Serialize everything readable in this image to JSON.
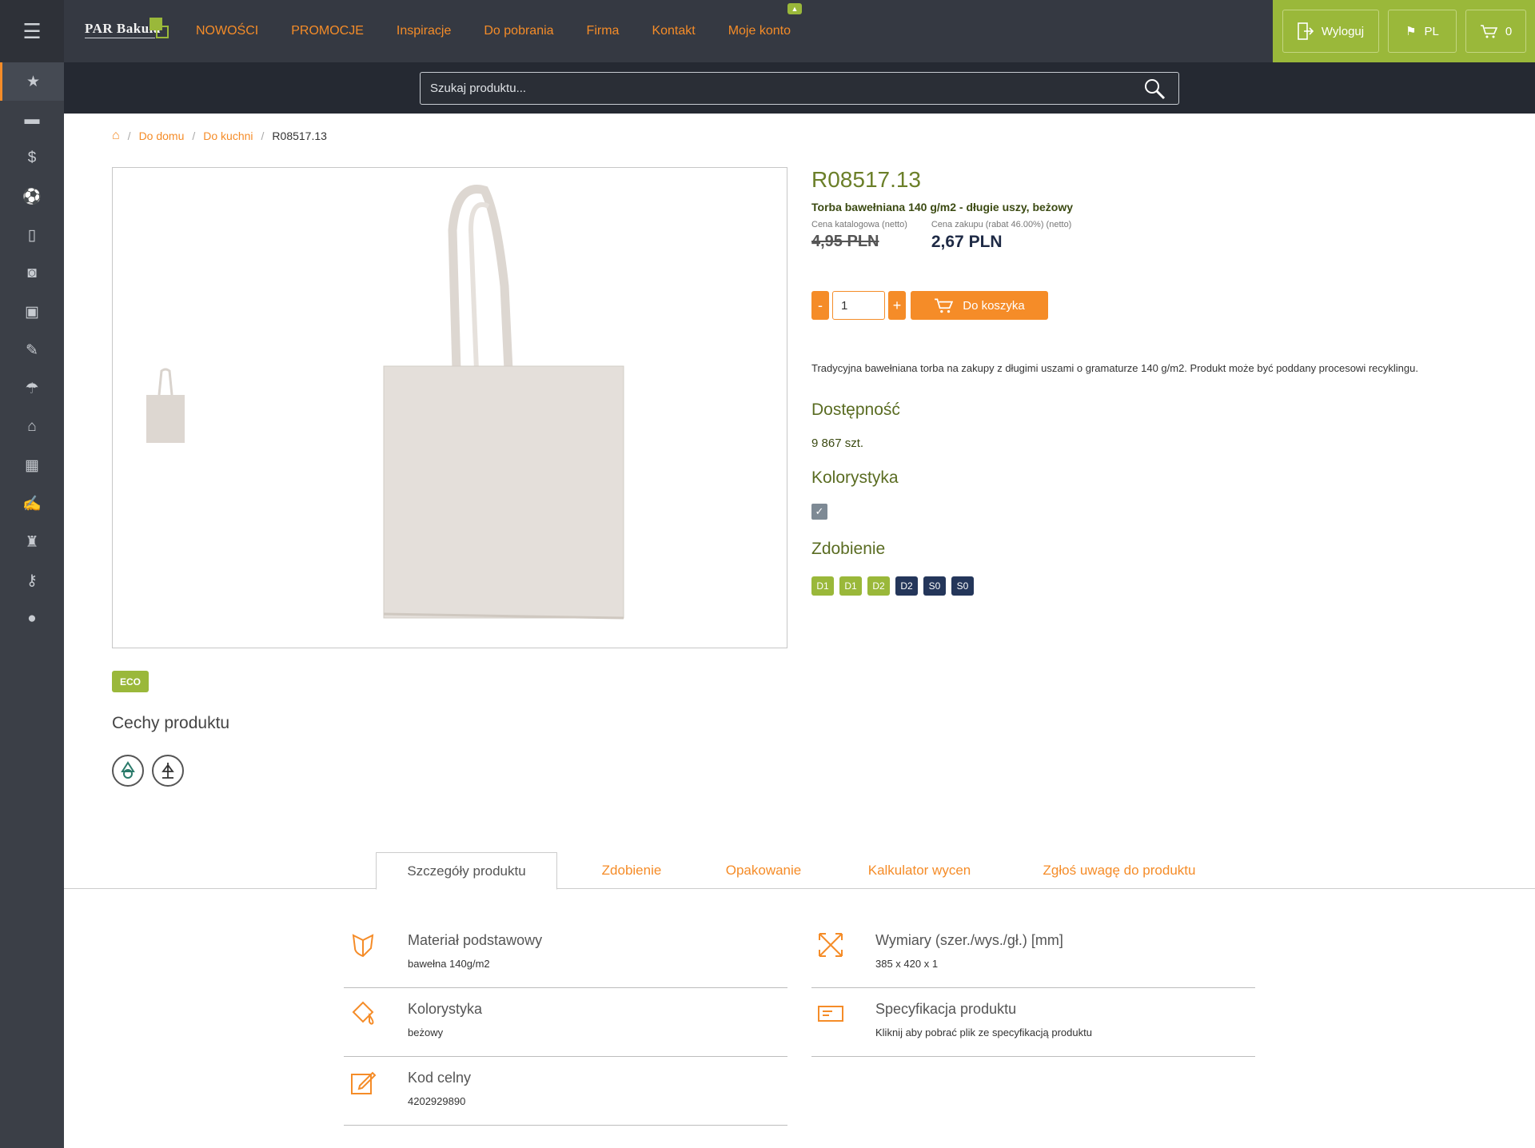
{
  "header": {
    "logo_text": "PAR Bakuła",
    "nav": [
      "NOWOŚCI",
      "PROMOCJE",
      "Inspiracje",
      "Do pobrania",
      "Firma",
      "Kontakt",
      "Moje konto"
    ],
    "logout_label": "Wyloguj",
    "language": "PL",
    "cart_count": "0"
  },
  "search": {
    "placeholder": "Szukaj produktu..."
  },
  "sidebar": {
    "icons": [
      "star-icon",
      "archive-icon",
      "dollar-icon",
      "ball-icon",
      "phone-icon",
      "cup-icon",
      "briefcase-icon",
      "wrench-icon",
      "umbrella-icon",
      "home-icon",
      "calculator-icon",
      "pen-icon",
      "figure-icon",
      "key-icon",
      "user-icon"
    ]
  },
  "breadcrumb": {
    "items": [
      "Do domu",
      "Do kuchni"
    ],
    "current": "R08517.13"
  },
  "product": {
    "sku": "R08517.13",
    "name": "Torba bawełniana 140 g/m2 - długie uszy, beżowy",
    "catalog_price_label": "Cena katalogowa (netto)",
    "catalog_price": "4,95 PLN",
    "purchase_price_label": "Cena zakupu (rabat 46.00%) (netto)",
    "purchase_price": "2,67 PLN",
    "quantity": "1",
    "minus_label": "-",
    "plus_label": "+",
    "add_to_cart_label": "Do koszyka",
    "description": "Tradycyjna bawełniana torba na zakupy z długimi uszami o gramaturze 140 g/m2. Produkt może być poddany procesowi recyklingu.",
    "availability_title": "Dostępność",
    "availability_value": "9 867 szt.",
    "color_title": "Kolorystyka",
    "decoration_title": "Zdobienie",
    "decoration_tags": [
      {
        "label": "D1",
        "color": "#9ab83a"
      },
      {
        "label": "D1",
        "color": "#9ab83a"
      },
      {
        "label": "D2",
        "color": "#9ab83a"
      },
      {
        "label": "D2",
        "color": "#24365a"
      },
      {
        "label": "S0",
        "color": "#24365a"
      },
      {
        "label": "S0",
        "color": "#24365a"
      }
    ],
    "eco_label": "ECO",
    "features_title": "Cechy produktu"
  },
  "tabs": [
    "Szczegóły produktu",
    "Zdobienie",
    "Opakowanie",
    "Kalkulator wycen",
    "Zgłoś uwagę do produktu"
  ],
  "details": {
    "material_label": "Materiał podstawowy",
    "material_value": "bawełna 140g/m2",
    "color_label": "Kolorystyka",
    "color_value": "beżowy",
    "customs_label": "Kod celny",
    "customs_value": "4202929890",
    "dimensions_label": "Wymiary (szer./wys./gł.) [mm]",
    "dimensions_value": "385 x 420 x 1",
    "spec_label": "Specyfikacja produktu",
    "spec_value": "Kliknij aby pobrać plik ze specyfikacją produktu"
  },
  "colors": {
    "accent": "#f58c28",
    "brand_green": "#9ab83a",
    "dark": "#353942"
  }
}
